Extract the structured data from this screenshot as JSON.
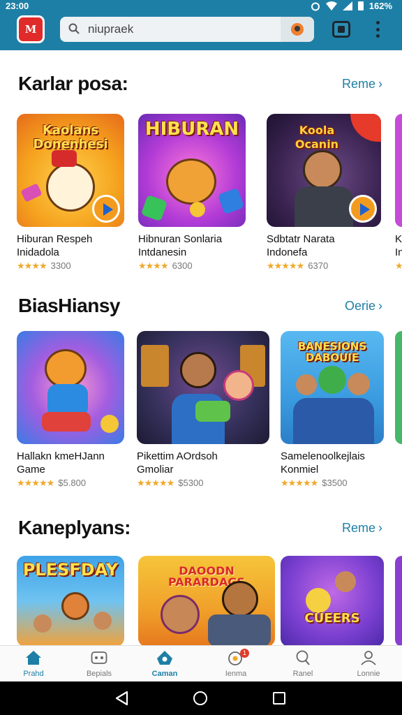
{
  "status": {
    "time": "23:00",
    "battery": "162%"
  },
  "header": {
    "logo_text": "M",
    "search_value": "niupraek",
    "icons": [
      "search-icon",
      "mic-icon",
      "cast-icon",
      "more-vert-icon"
    ]
  },
  "sections": [
    {
      "title": "Karlar posa:",
      "more": "Reme",
      "items": [
        {
          "thumb_text": "Kaolans Donenhesi",
          "name1": "Hiburan Respeh",
          "name2": "Inidadola",
          "stars": "★★★★",
          "rating": "3300"
        },
        {
          "thumb_text": "HIBURAN",
          "name1": "Hibnuran Sonlaria",
          "name2": "Intdanesin",
          "stars": "★★★★",
          "rating": "6300"
        },
        {
          "thumb_text": "Koola Ocanin",
          "name1": "Sdbtatr Narata",
          "name2": "Indonefa",
          "stars": "★★★★★",
          "rating": "6370"
        },
        {
          "thumb_text": "",
          "name1": "K",
          "name2": "In",
          "stars": "★",
          "rating": ""
        }
      ]
    },
    {
      "title": "BiasHiansy",
      "more": "Oerie",
      "items": [
        {
          "thumb_text": "",
          "name1": "Hallakn kmeHJann",
          "name2": "Game",
          "stars": "★★★★★",
          "rating": "$5.800"
        },
        {
          "thumb_text": "",
          "name1": "Pikettim AOrdsoh",
          "name2": "Gmoliar",
          "stars": "★★★★★",
          "rating": "$5300"
        },
        {
          "thumb_text": "BANESIONS DABOUIE",
          "name1": "Samelenoolkejlais",
          "name2": "Konmiel",
          "stars": "★★★★★",
          "rating": "$3500"
        }
      ]
    },
    {
      "title": "Kaneplyans:",
      "more": "Reme",
      "items": [
        {
          "thumb_text": "PLESFDAY"
        },
        {
          "thumb_text": "DAOODN PARARDAGS"
        },
        {
          "thumb_text": "CUEERS"
        }
      ]
    }
  ],
  "bottom_nav": [
    {
      "label": "Prahd",
      "icon": "home-icon",
      "active": false
    },
    {
      "label": "Bepials",
      "icon": "gamepad-icon",
      "active": false
    },
    {
      "label": "Caman",
      "icon": "apps-icon",
      "active": true
    },
    {
      "label": "Ienma",
      "icon": "notifications-icon",
      "badge": "1",
      "active": false
    },
    {
      "label": "Ranel",
      "icon": "search-icon",
      "active": false
    },
    {
      "label": "Lonnie",
      "icon": "account-icon",
      "active": false
    }
  ],
  "colors": {
    "header": "#1e7fa6",
    "accent": "#1e7fa6",
    "star": "#f0a92b",
    "logo": "#e12a2a"
  }
}
